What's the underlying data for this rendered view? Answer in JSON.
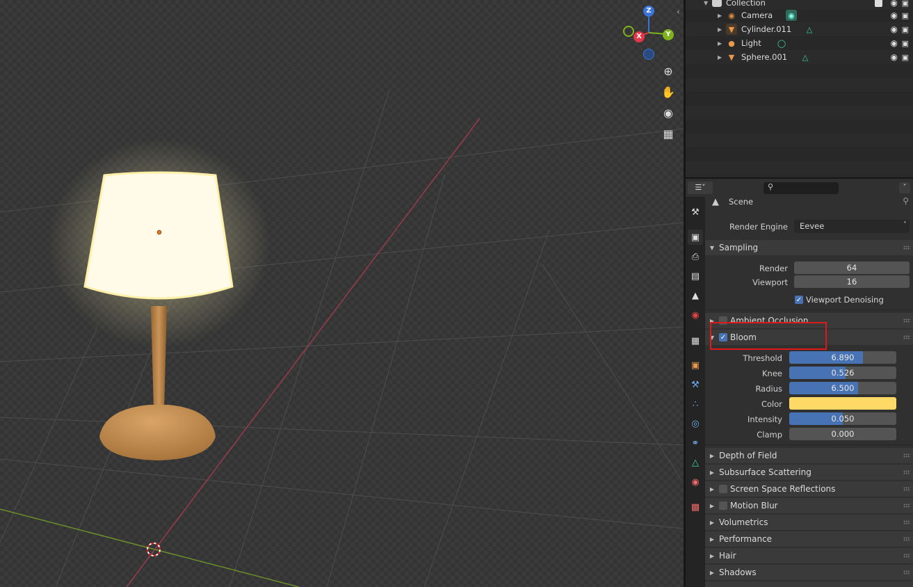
{
  "outliner": {
    "collection_label": "Collection",
    "items": [
      {
        "name": "Camera",
        "icon": "camera-object-icon",
        "data_icon": "camera-data-icon",
        "color": "#d88a3a"
      },
      {
        "name": "Cylinder.011",
        "icon": "mesh-object-icon",
        "data_icon": "mesh-data-icon",
        "color": "#d88a3a"
      },
      {
        "name": "Light",
        "icon": "light-object-icon",
        "data_icon": "light-data-icon",
        "color": "#d88a3a"
      },
      {
        "name": "Sphere.001",
        "icon": "mesh-object-icon",
        "data_icon": "mesh-data-icon",
        "color": "#d88a3a"
      }
    ]
  },
  "gizmo": {
    "z": "Z",
    "y": "Y",
    "x": "X"
  },
  "properties": {
    "search_placeholder": "",
    "context_label": "Scene",
    "render_engine_label": "Render Engine",
    "render_engine_value": "Eevee",
    "sampling": {
      "title": "Sampling",
      "render_label": "Render",
      "render_value": "64",
      "viewport_label": "Viewport",
      "viewport_value": "16",
      "denoise_label": "Viewport Denoising",
      "denoise_checked": true
    },
    "ambient_occlusion": {
      "title": "Ambient Occlusion",
      "checked": false
    },
    "bloom": {
      "title": "Bloom",
      "checked": true,
      "threshold_label": "Threshold",
      "threshold_value": "6.890",
      "threshold_fill": 0.7,
      "knee_label": "Knee",
      "knee_value": "0.526",
      "knee_fill": 0.526,
      "radius_label": "Radius",
      "radius_value": "6.500",
      "radius_fill": 0.65,
      "color_label": "Color",
      "color_value": "#ffd966",
      "intensity_label": "Intensity",
      "intensity_value": "0.050",
      "intensity_fill": 0.5,
      "clamp_label": "Clamp",
      "clamp_value": "0.000",
      "clamp_fill": 0
    },
    "collapsed_panels": [
      {
        "title": "Depth of Field",
        "has_checkbox": false
      },
      {
        "title": "Subsurface Scattering",
        "has_checkbox": false
      },
      {
        "title": "Screen Space Reflections",
        "has_checkbox": true
      },
      {
        "title": "Motion Blur",
        "has_checkbox": true
      },
      {
        "title": "Volumetrics",
        "has_checkbox": false
      },
      {
        "title": "Performance",
        "has_checkbox": false
      },
      {
        "title": "Hair",
        "has_checkbox": false
      },
      {
        "title": "Shadows",
        "has_checkbox": false
      }
    ]
  },
  "colors": {
    "accent": "#4772b3",
    "highlight": "#e01818",
    "lamp_glow": "#fff6c8"
  }
}
